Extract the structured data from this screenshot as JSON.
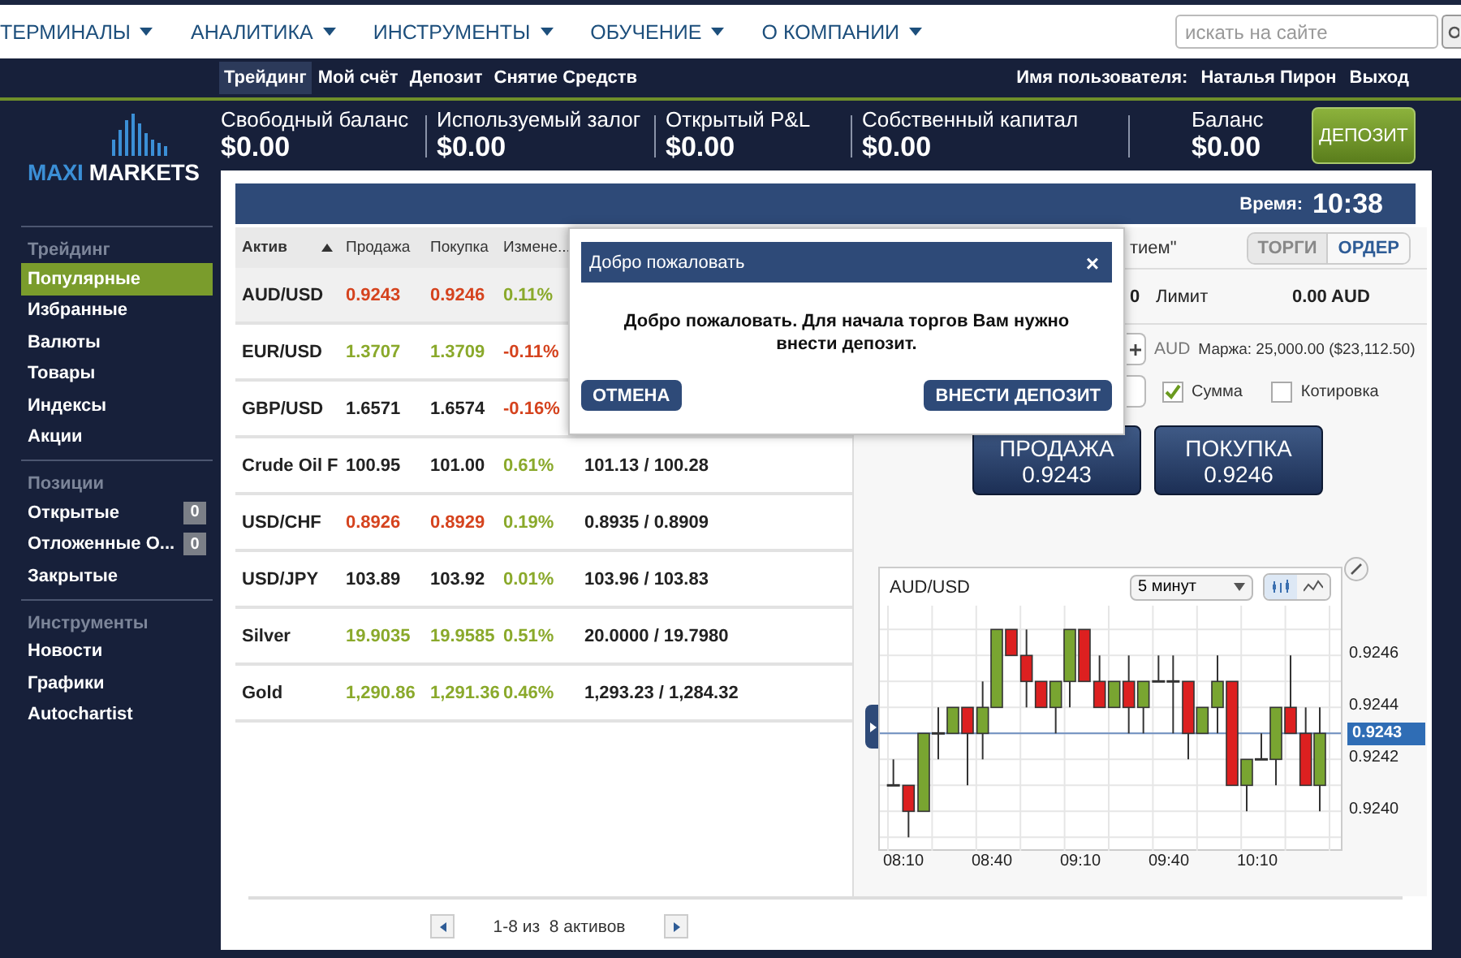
{
  "top_nav": {
    "items": [
      {
        "label": "ТЕРМИНАЛЫ"
      },
      {
        "label": "АНАЛИТИКА"
      },
      {
        "label": "ИНСТРУМЕНТЫ"
      },
      {
        "label": "ОБУЧЕНИЕ"
      },
      {
        "label": "О КОМПАНИИ"
      }
    ],
    "search": {
      "placeholder": "искать на сайте"
    }
  },
  "sub_nav": {
    "items": [
      {
        "label": "Трейдинг",
        "selected": true
      },
      {
        "label": "Мой счёт",
        "selected": false
      },
      {
        "label": "Депозит",
        "selected": false
      },
      {
        "label": "Снятие Средств",
        "selected": false
      }
    ],
    "user_label": "Имя пользователя:",
    "user_name": "Наталья Пирон",
    "logout": "Выход"
  },
  "logo": {
    "accent": "MAXI",
    "rest": "MARKETS"
  },
  "account": {
    "metrics": [
      {
        "label": "Свободный баланс",
        "value": "$0.00"
      },
      {
        "label": "Используемый залог",
        "value": "$0.00"
      },
      {
        "label": "Открытый P&L",
        "value": "$0.00"
      },
      {
        "label": "Собственный капитал",
        "value": "$0.00"
      }
    ],
    "balance": {
      "label": "Баланс",
      "value": "$0.00"
    },
    "deposit_button": "ДЕПОЗИТ"
  },
  "sidebar": {
    "sections": [
      {
        "title": "Трейдинг",
        "items": [
          {
            "label": "Популярные",
            "selected": true
          },
          {
            "label": "Избранные",
            "selected": false
          },
          {
            "label": "Валюты",
            "selected": false
          },
          {
            "label": "Товары",
            "selected": false
          },
          {
            "label": "Индексы",
            "selected": false
          },
          {
            "label": "Акции",
            "selected": false
          }
        ]
      },
      {
        "title": "Позиции",
        "items": [
          {
            "label": "Открытые",
            "selected": false,
            "count": "0"
          },
          {
            "label": "Отложенные О...",
            "selected": false,
            "count": "0"
          },
          {
            "label": "Закрытые",
            "selected": false
          }
        ]
      },
      {
        "title": "Инструменты",
        "items": [
          {
            "label": "Новости",
            "selected": false
          },
          {
            "label": "Графики",
            "selected": false
          },
          {
            "label": "Autochartist",
            "selected": false
          }
        ]
      }
    ]
  },
  "time": {
    "label": "Время:",
    "value": "10:38"
  },
  "assets_table": {
    "columns": [
      {
        "label": "Актив",
        "sorted": true
      },
      {
        "label": "Продажа",
        "sorted": false
      },
      {
        "label": "Покупка",
        "sorted": false
      },
      {
        "label": "Измене...",
        "sorted": false
      }
    ],
    "rows": [
      {
        "asset": "AUD/USD",
        "selected": true,
        "sell": {
          "text": "0.9243",
          "color": "#d5431e"
        },
        "buy": {
          "text": "0.9246",
          "color": "#d5431e"
        },
        "change": {
          "text": "0.11%",
          "color": "#8aa92b"
        }
      },
      {
        "asset": "EUR/USD",
        "selected": false,
        "sell": {
          "text": "1.3707",
          "color": "#8aa92b"
        },
        "buy": {
          "text": "1.3709",
          "color": "#8aa92b"
        },
        "change": {
          "text": "-0.11%",
          "color": "#d5431e"
        }
      },
      {
        "asset": "GBP/USD",
        "selected": false,
        "sell": {
          "text": "1.6571",
          "color": "#222222"
        },
        "buy": {
          "text": "1.6574",
          "color": "#222222"
        },
        "change": {
          "text": "-0.16%",
          "color": "#d5431e"
        }
      },
      {
        "asset": "Crude Oil F",
        "selected": false,
        "sell": {
          "text": "100.95",
          "color": "#222222"
        },
        "buy": {
          "text": "101.00",
          "color": "#222222"
        },
        "change": {
          "text": "0.61%",
          "color": "#8aa92b"
        },
        "range": "101.13 / 100.28"
      },
      {
        "asset": "USD/CHF",
        "selected": false,
        "sell": {
          "text": "0.8926",
          "color": "#d5431e"
        },
        "buy": {
          "text": "0.8929",
          "color": "#d5431e"
        },
        "change": {
          "text": "0.19%",
          "color": "#8aa92b"
        },
        "range": "0.8935 / 0.8909"
      },
      {
        "asset": "USD/JPY",
        "selected": false,
        "sell": {
          "text": "103.89",
          "color": "#222222"
        },
        "buy": {
          "text": "103.92",
          "color": "#222222"
        },
        "change": {
          "text": "0.01%",
          "color": "#8aa92b"
        },
        "range": "103.96 / 103.83"
      },
      {
        "asset": "Silver",
        "selected": false,
        "sell": {
          "text": "19.9035",
          "color": "#8aa92b"
        },
        "buy": {
          "text": "19.9585",
          "color": "#8aa92b"
        },
        "change": {
          "text": "0.51%",
          "color": "#8aa92b"
        },
        "range": "20.0000 / 19.7980"
      },
      {
        "asset": "Gold",
        "selected": false,
        "sell": {
          "text": "1,290.86",
          "color": "#8aa92b"
        },
        "buy": {
          "text": "1,291.36",
          "color": "#8aa92b"
        },
        "change": {
          "text": "0.46%",
          "color": "#8aa92b"
        },
        "range": "1,293.23 / 1,284.32"
      }
    ]
  },
  "trade": {
    "mode_label": "тием\"",
    "tabs": [
      {
        "label": "ТОРГИ",
        "selected": false
      },
      {
        "label": "ОРДЕР",
        "selected": true
      }
    ],
    "amount": "0",
    "limit_label": "Лимит",
    "limit_value": "0.00 AUD",
    "currency": "AUD",
    "margin": "Маржа: 25,000.00 ($23,112.50)",
    "options": [
      {
        "label": "Сумма",
        "checked": true
      },
      {
        "label": "Котировка",
        "checked": false
      }
    ],
    "sell_button": {
      "label": "ПРОДАЖА",
      "price": "0.9243"
    },
    "buy_button": {
      "label": "ПОКУПКА",
      "price": "0.9246"
    }
  },
  "chart": {
    "symbol": "AUD/USD",
    "interval": "5 минут",
    "chart_types": [
      {
        "kind": "candles",
        "selected": true
      },
      {
        "kind": "line",
        "selected": false
      }
    ],
    "y_labels": [
      "0.9246",
      "0.9244",
      "0.9242",
      "0.9240"
    ],
    "current_price": "0.9243",
    "x_labels": [
      "08:10",
      "08:40",
      "09:10",
      "09:40",
      "10:10"
    ]
  },
  "pager": {
    "text": "1-8 из  8 активов"
  },
  "dialog": {
    "title": "Добро пожаловать",
    "close": "×",
    "message": "Добро пожаловать. Для начала торгов Вам нужно внести депозит.",
    "cancel": "ОТМЕНА",
    "confirm": "ВНЕСТИ ДЕПОЗИТ"
  }
}
